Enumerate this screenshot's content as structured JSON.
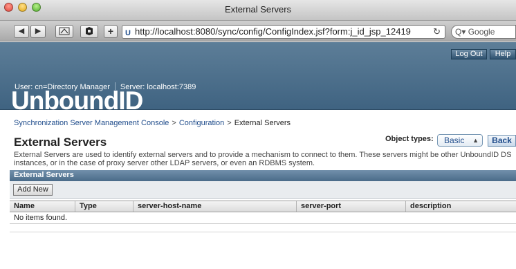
{
  "window": {
    "title": "External Servers"
  },
  "toolbar": {
    "back_label": "◀",
    "forward_label": "▶",
    "add_label": "+",
    "url": "http://localhost:8080/sync/config/ConfigIndex.jsf?form:j_id_jsp_12419",
    "search_placeholder": "Q▾ Google"
  },
  "header": {
    "logout_label": "Log Out",
    "help_label": "Help",
    "user_text": "User: cn=Directory Manager",
    "server_text": "Server: localhost:7389",
    "logo_text": "UnboundID"
  },
  "breadcrumb": {
    "items": [
      "Synchronization Server Management Console",
      "Configuration",
      "External Servers"
    ],
    "separator": ">"
  },
  "page": {
    "title": "External Servers",
    "object_types_label": "Object types:",
    "object_types_value": "Basic",
    "back_label": "Back",
    "description": "External Servers are used to identify external servers and to provide a mechanism to connect to them. These servers might be other UnboundID DS instances, or in the case of proxy server other LDAP servers, or even an RDBMS system."
  },
  "section": {
    "title": "External Servers",
    "add_new_label": "Add New"
  },
  "table": {
    "columns": [
      "Name",
      "Type",
      "server-host-name",
      "server-port",
      "description"
    ],
    "empty_message": "No items found."
  },
  "colors": {
    "header_bg": "#4f7190",
    "link": "#1f4c8b",
    "section_bg": "#5a7b98"
  }
}
